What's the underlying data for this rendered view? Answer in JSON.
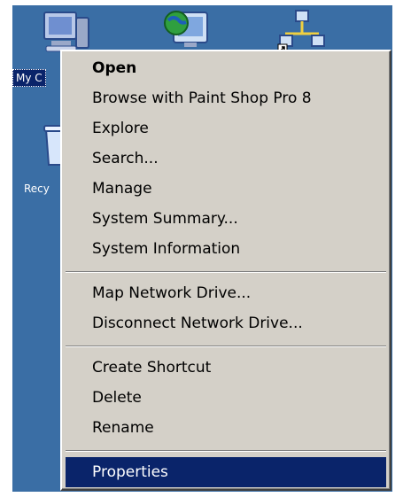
{
  "desktop": {
    "background_color": "#3a6ea5",
    "icons": [
      {
        "label": "My C",
        "icon": "my-computer-icon",
        "selected": true
      },
      {
        "label": "Recy",
        "icon": "recycle-bin-icon",
        "selected": false
      },
      {
        "label": "",
        "icon": "internet-explorer-icon",
        "selected": false
      },
      {
        "label": "",
        "icon": "network-places-icon",
        "selected": false
      }
    ]
  },
  "context_menu": {
    "items": [
      {
        "label": "Open",
        "bold": true,
        "highlighted": false
      },
      {
        "label": "Browse with Paint Shop Pro 8",
        "bold": false,
        "highlighted": false
      },
      {
        "label": "Explore",
        "bold": false,
        "highlighted": false
      },
      {
        "label": "Search...",
        "bold": false,
        "highlighted": false
      },
      {
        "label": "Manage",
        "bold": false,
        "highlighted": false
      },
      {
        "label": "System Summary...",
        "bold": false,
        "highlighted": false
      },
      {
        "label": "System Information",
        "bold": false,
        "highlighted": false
      },
      {
        "label": "Map Network Drive...",
        "bold": false,
        "highlighted": false
      },
      {
        "label": "Disconnect Network Drive...",
        "bold": false,
        "highlighted": false
      },
      {
        "label": "Create Shortcut",
        "bold": false,
        "highlighted": false
      },
      {
        "label": "Delete",
        "bold": false,
        "highlighted": false
      },
      {
        "label": "Rename",
        "bold": false,
        "highlighted": false
      },
      {
        "label": "Properties",
        "bold": false,
        "highlighted": true
      }
    ],
    "highlight_color": "#0a246a",
    "menu_color": "#d4d0c8"
  }
}
